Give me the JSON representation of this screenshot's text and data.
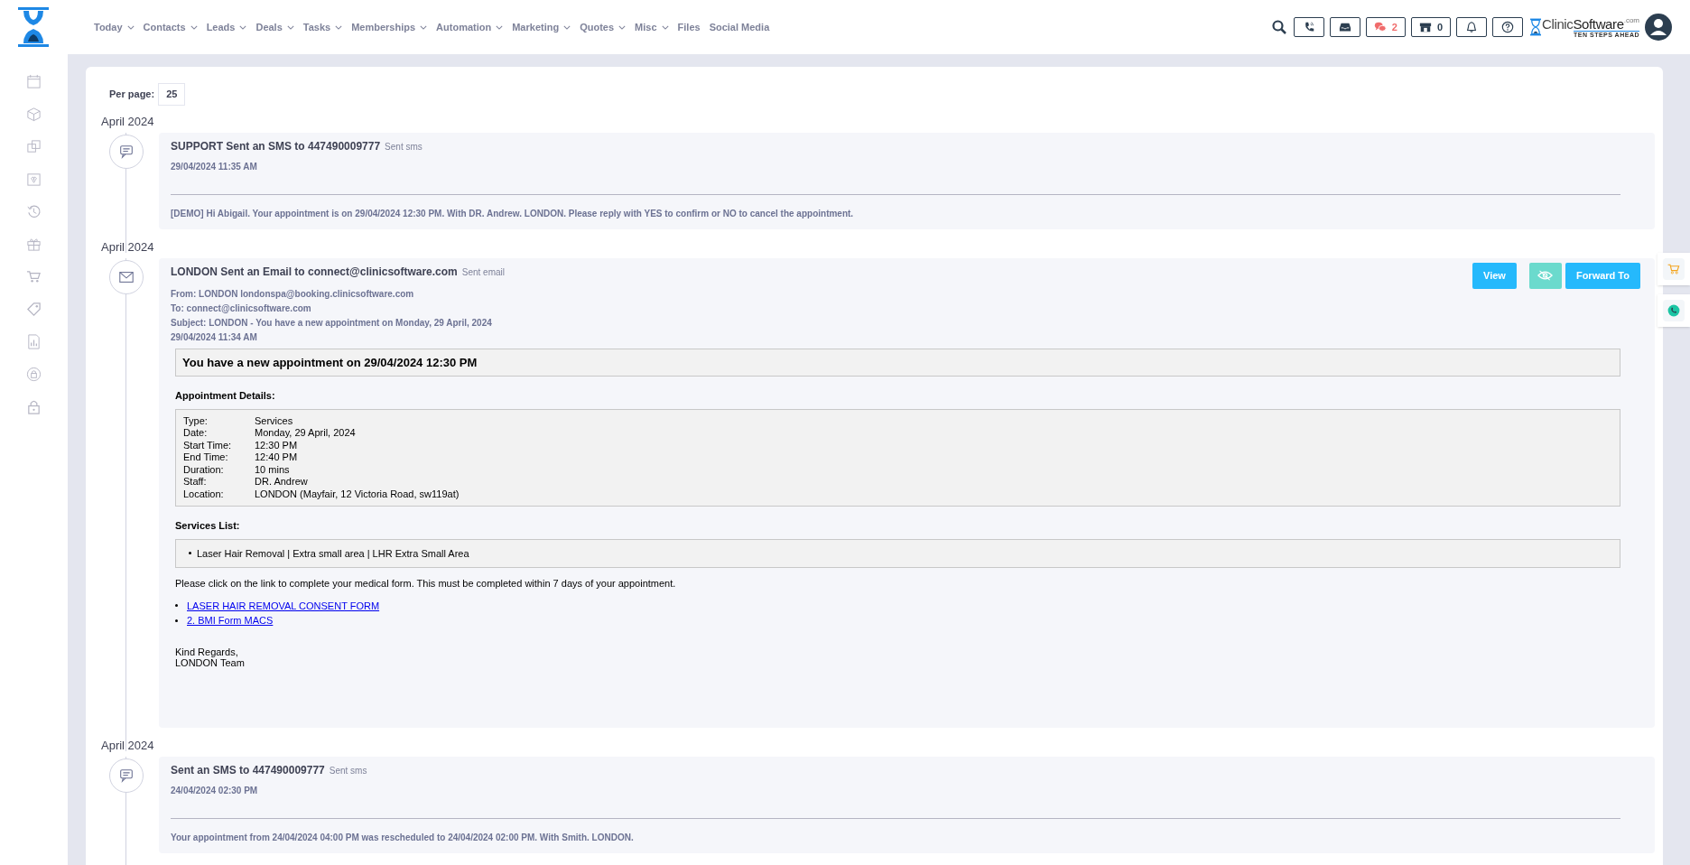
{
  "nav": {
    "menu": [
      {
        "label": "Today",
        "dropdown": true
      },
      {
        "label": "Contacts",
        "dropdown": true
      },
      {
        "label": "Leads",
        "dropdown": true
      },
      {
        "label": "Deals",
        "dropdown": true
      },
      {
        "label": "Tasks",
        "dropdown": true
      },
      {
        "label": "Memberships",
        "dropdown": true
      },
      {
        "label": "Automation",
        "dropdown": true
      },
      {
        "label": "Marketing",
        "dropdown": true
      },
      {
        "label": "Quotes",
        "dropdown": true
      },
      {
        "label": "Misc",
        "dropdown": true
      },
      {
        "label": "Files",
        "dropdown": false
      },
      {
        "label": "Social Media",
        "dropdown": false
      }
    ],
    "tools": [
      {
        "kind": "phone"
      },
      {
        "kind": "inbox"
      },
      {
        "kind": "chat",
        "count": "2"
      },
      {
        "kind": "store",
        "count": "0"
      },
      {
        "kind": "bell"
      },
      {
        "kind": "help"
      }
    ],
    "brand": {
      "name_1": "Clinic",
      "name_2": "Software",
      "suffix": ".com",
      "tagline": "TEN STEPS AHEAD"
    }
  },
  "sidebar": [
    {
      "kind": "calendar"
    },
    {
      "kind": "cube"
    },
    {
      "kind": "copy"
    },
    {
      "kind": "gift-box"
    },
    {
      "kind": "history"
    },
    {
      "kind": "gift"
    },
    {
      "kind": "cart"
    },
    {
      "kind": "tag"
    },
    {
      "kind": "report"
    },
    {
      "kind": "lock-circle"
    },
    {
      "kind": "lock"
    }
  ],
  "per_page": {
    "label": "Per page:",
    "value": "25"
  },
  "entries": [
    {
      "date_heading": "April 2024",
      "kind": "sms",
      "title": "SUPPORT Sent an SMS to 447490009777",
      "tag": "Sent sms",
      "timestamp": "29/04/2024 11:35 AM",
      "message": "[DEMO] Hi Abigail. Your appointment is on 29/04/2024 12:30 PM. With DR. Andrew. LONDON. Please reply with YES to confirm or NO to cancel the appointment."
    },
    {
      "date_heading": "April 2024",
      "kind": "email",
      "title": "LONDON Sent an Email to connect@clinicsoftware.com",
      "tag": "Sent email",
      "headers": [
        "From: LONDON londonspa@booking.clinicsoftware.com",
        "To: connect@clinicsoftware.com",
        "Subject: LONDON - You have a new appointment on Monday, 29 April, 2024"
      ],
      "timestamp": "29/04/2024 11:34 AM",
      "actions": [
        {
          "kind": "text",
          "label": "View"
        },
        {
          "kind": "hide"
        },
        {
          "kind": "text",
          "label": "Forward To"
        }
      ],
      "body": {
        "heading": "You have a new appointment on 29/04/2024 12:30 PM",
        "details_title": "Appointment Details:",
        "details": [
          {
            "label": "Type:",
            "value": "Services"
          },
          {
            "label": "Date:",
            "value": "Monday, 29 April, 2024"
          },
          {
            "label": "Start Time:",
            "value": "12:30 PM"
          },
          {
            "label": "End Time:",
            "value": "12:40 PM"
          },
          {
            "label": "Duration:",
            "value": "10 mins"
          },
          {
            "label": "Staff:",
            "value": "DR. Andrew"
          },
          {
            "label": "Location:",
            "value": "LONDON (Mayfair, 12 Victoria Road, sw119at)"
          }
        ],
        "services_title": "Services List:",
        "services": [
          "Laser Hair Removal | Extra small area | LHR Extra Small Area"
        ],
        "note": "Please click on the link to complete your medical form. This must be completed within 7 days of your appointment.",
        "links": [
          "LASER HAIR REMOVAL CONSENT FORM",
          "2. BMI Form MACS"
        ],
        "signoff": [
          "Kind Regards,",
          "LONDON Team"
        ]
      }
    },
    {
      "date_heading": "April 2024",
      "kind": "sms",
      "title": "Sent an SMS to 447490009777",
      "tag": "Sent sms",
      "timestamp": "24/04/2024 02:30 PM",
      "message": "Your appointment from 24/04/2024 04:00 PM was rescheduled to 24/04/2024 02:00 PM. With Smith. LONDON."
    }
  ],
  "floating": [
    {
      "kind": "cart"
    },
    {
      "kind": "whatsapp"
    }
  ]
}
